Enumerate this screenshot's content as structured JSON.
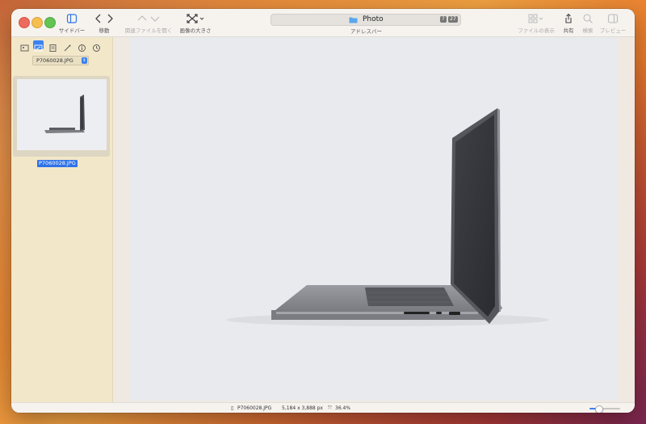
{
  "window": {
    "address_bar": {
      "title": "Photo",
      "label": "アドレスバー",
      "badge_question": "?",
      "badge_count": "27"
    },
    "toolbar": {
      "sidebar_label": "サイドバー",
      "move_label": "移動",
      "open_related_label": "関連ファイルを開く",
      "image_size_label": "画像の大きさ",
      "file_view_label": "ファイルの表示",
      "share_label": "共有",
      "search_label": "検索",
      "preview_label": "プレビュー"
    }
  },
  "sidebar": {
    "tools": [
      "folder-view-icon",
      "image-view-icon",
      "list-icon",
      "magic-wand-icon",
      "info-icon",
      "clock-icon"
    ],
    "active_tool": 1,
    "file_select": "P7060028.JPG",
    "thumbnail_label": "P7060028.JPG"
  },
  "statusbar": {
    "filename": "P7060028.JPG",
    "dimensions": "5,184 x 3,888 px",
    "zoom": "36.4%",
    "zoom_slider_fraction": 0.3
  }
}
